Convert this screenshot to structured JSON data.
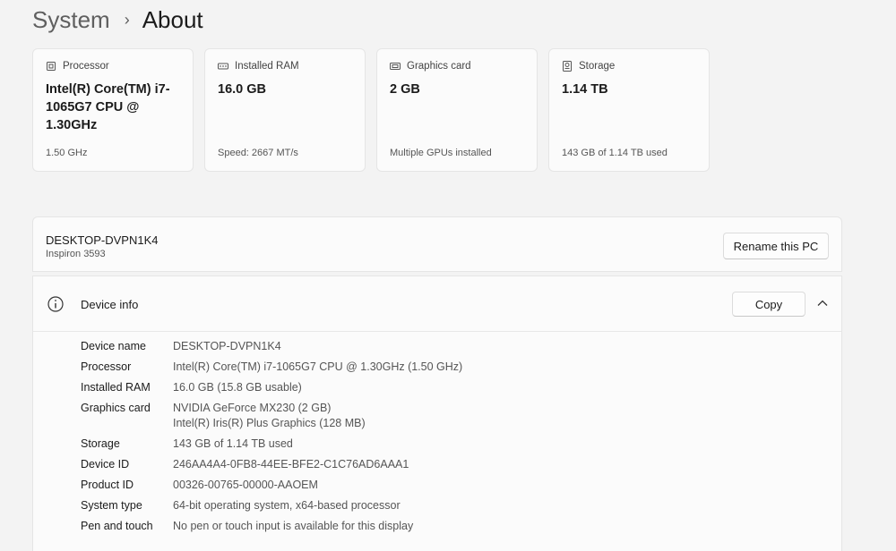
{
  "breadcrumb": {
    "parent": "System",
    "separator": "›",
    "current": "About"
  },
  "cards": [
    {
      "icon": "processor-icon",
      "label": "Processor",
      "value": "Intel(R) Core(TM) i7-1065G7 CPU @ 1.30GHz",
      "sub": "1.50 GHz"
    },
    {
      "icon": "ram-icon",
      "label": "Installed RAM",
      "value": "16.0 GB",
      "sub": "Speed: 2667 MT/s"
    },
    {
      "icon": "graphics-card-icon",
      "label": "Graphics card",
      "value": "2 GB",
      "sub": "Multiple GPUs installed"
    },
    {
      "icon": "storage-icon",
      "label": "Storage",
      "value": "1.14 TB",
      "sub": "143 GB of 1.14 TB used"
    }
  ],
  "pc": {
    "name": "DESKTOP-DVPN1K4",
    "model": "Inspiron 3593",
    "rename_label": "Rename this PC"
  },
  "device_info": {
    "title": "Device info",
    "copy_label": "Copy",
    "rows": [
      {
        "label": "Device name",
        "value": "DESKTOP-DVPN1K4"
      },
      {
        "label": "Processor",
        "value": "Intel(R) Core(TM) i7-1065G7 CPU @ 1.30GHz (1.50 GHz)"
      },
      {
        "label": "Installed RAM",
        "value": "16.0 GB (15.8 GB usable)"
      },
      {
        "label": "Graphics card",
        "value": "NVIDIA GeForce MX230 (2 GB)",
        "value2": "Intel(R) Iris(R) Plus Graphics (128 MB)"
      },
      {
        "label": "Storage",
        "value": "143 GB of 1.14 TB used"
      },
      {
        "label": "Device ID",
        "value": "246AA4A4-0FB8-44EE-BFE2-C1C76AD6AAA1"
      },
      {
        "label": "Product ID",
        "value": "00326-00765-00000-AAOEM"
      },
      {
        "label": "System type",
        "value": "64-bit operating system, x64-based processor"
      },
      {
        "label": "Pen and touch",
        "value": "No pen or touch input is available for this display"
      }
    ]
  }
}
